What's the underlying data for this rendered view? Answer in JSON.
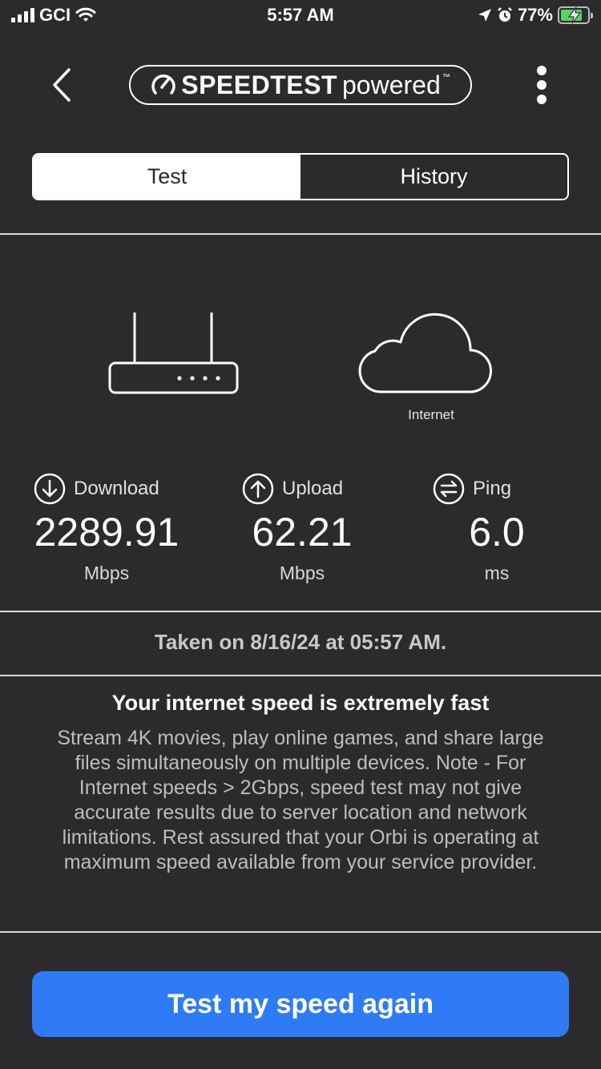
{
  "status_bar": {
    "carrier": "GCI",
    "time": "5:57 AM",
    "battery_percent": "77%",
    "battery_color": "#4cd964"
  },
  "header": {
    "back_icon": "chevron-left-icon",
    "logo_brand": "SPEEDTEST",
    "logo_sub": "powered",
    "logo_tm": "™",
    "more_icon": "vertical-ellipsis-icon"
  },
  "tabs": [
    {
      "label": "Test",
      "active": true
    },
    {
      "label": "History",
      "active": false
    }
  ],
  "devices": {
    "internet_label": "Internet"
  },
  "metrics": {
    "download": {
      "label": "Download",
      "value": "2289.91",
      "unit": "Mbps",
      "icon": "arrow-down-circle-icon"
    },
    "upload": {
      "label": "Upload",
      "value": "62.21",
      "unit": "Mbps",
      "icon": "arrow-up-circle-icon"
    },
    "ping": {
      "label": "Ping",
      "value": "6.0",
      "unit": "ms",
      "icon": "ping-arrows-circle-icon"
    }
  },
  "taken_on": "Taken on 8/16/24 at 05:57 AM.",
  "result": {
    "title": "Your internet speed is extremely fast",
    "description": "Stream 4K movies, play online games, and share large files simultaneously on multiple devices. Note - For Internet speeds > 2Gbps, speed test may not give accurate results due to server location and network limitations. Rest assured that your Orbi is operating at maximum speed available from your service provider."
  },
  "cta_label": "Test my speed again",
  "colors": {
    "background": "#2d2a2e",
    "accent": "#2f7bf5"
  }
}
